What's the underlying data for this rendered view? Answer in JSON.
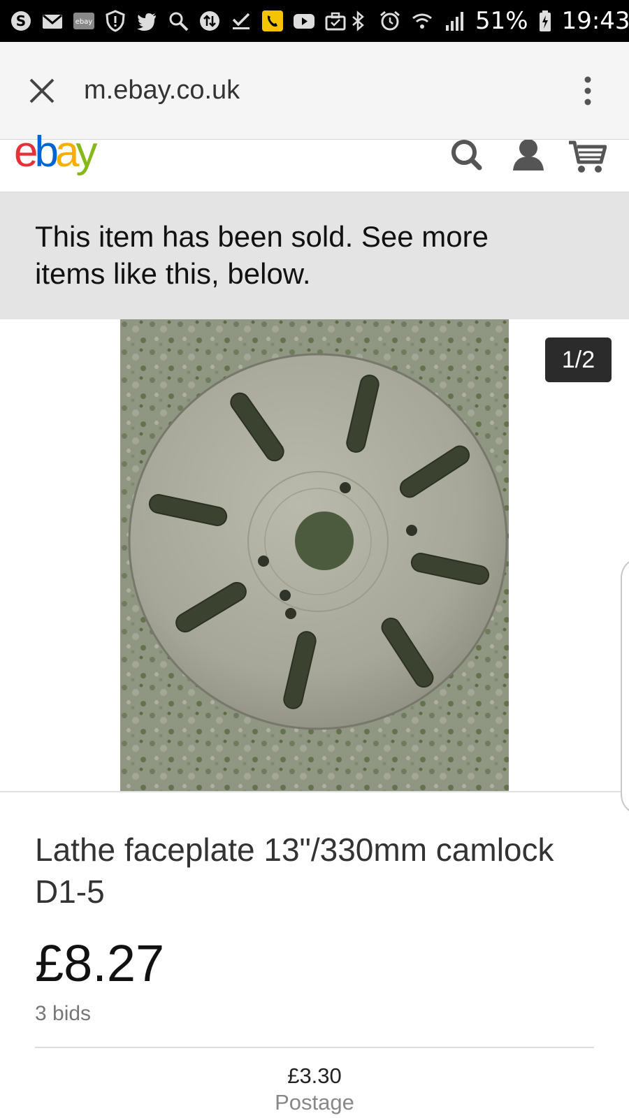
{
  "status_bar": {
    "left_icons": [
      "skype-icon",
      "gmail-icon",
      "ebay-app-icon",
      "alert-shield-icon",
      "twitter-icon",
      "search-app-icon",
      "sync-icon",
      "download-done-icon",
      "phone-call-icon",
      "youtube-icon",
      "briefcase-icon"
    ],
    "right_icons": [
      "bluetooth-icon",
      "alarm-icon",
      "wifi-icon",
      "signal-icon"
    ],
    "battery_percent": "51%",
    "time": "19:43"
  },
  "browser": {
    "url": "m.ebay.co.uk"
  },
  "header": {
    "logo_letters": [
      "e",
      "b",
      "a",
      "y"
    ],
    "logo_colors": [
      "#e53238",
      "#0064d2",
      "#f5af02",
      "#86b817"
    ]
  },
  "banner": {
    "text": "This item has been sold. See more items like this, below."
  },
  "gallery": {
    "counter": "1/2"
  },
  "item": {
    "title": "Lathe faceplate 13\"/330mm camlock D1-5",
    "price": "£8.27",
    "bids": "3 bids",
    "postage_price": "£3.30",
    "postage_label": "Postage"
  }
}
